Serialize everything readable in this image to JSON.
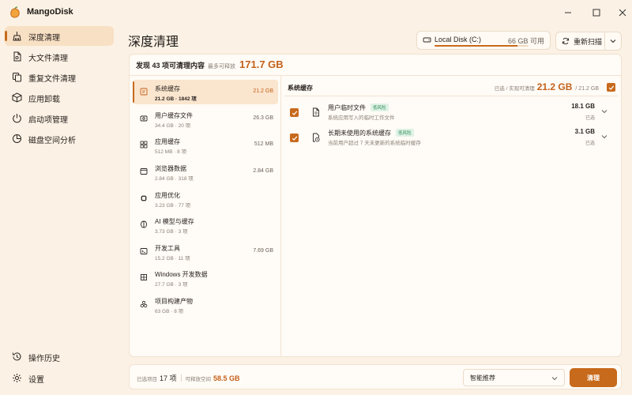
{
  "app": {
    "title": "MangoDisk",
    "accent": "#c76a1c",
    "accent_text": "#c4611a",
    "background": "#fbf1e4"
  },
  "sidebar": {
    "items": [
      {
        "label": "深度清理",
        "icon": "broom-icon",
        "active": true
      },
      {
        "label": "大文件清理",
        "icon": "large-file-icon",
        "active": false
      },
      {
        "label": "重复文件清理",
        "icon": "duplicate-file-icon",
        "active": false
      },
      {
        "label": "应用卸载",
        "icon": "package-icon",
        "active": false
      },
      {
        "label": "启动项管理",
        "icon": "power-icon",
        "active": false
      },
      {
        "label": "磁盘空间分析",
        "icon": "pie-chart-icon",
        "active": false
      }
    ],
    "bottom_items": [
      {
        "label": "操作历史",
        "icon": "history-icon"
      },
      {
        "label": "设置",
        "icon": "gear-icon"
      }
    ]
  },
  "header": {
    "page_title": "深度清理",
    "disk": {
      "name": "Local Disk (C:)",
      "free": "66 GB 可用",
      "used_fraction": 0.88
    },
    "rescan_label": "重新扫描"
  },
  "summary": {
    "label": "发现 43 项可清理内容",
    "sub": "最多可释放",
    "total": "171.7 GB"
  },
  "categories": [
    {
      "name": "系统缓存",
      "meta": "21.2 GB · 1842 项",
      "size": "21.2 GB",
      "icon": "system-cache-icon",
      "active": true
    },
    {
      "name": "用户缓存文件",
      "meta": "34.4 GB · 20 项",
      "size": "26.3 GB",
      "icon": "user-cache-icon",
      "active": false
    },
    {
      "name": "应用缓存",
      "meta": "512 MB · 8 项",
      "size": "512 MB",
      "icon": "app-cache-icon",
      "active": false
    },
    {
      "name": "浏览器数据",
      "meta": "2.84 GB · 318 项",
      "size": "2.84 GB",
      "icon": "browser-icon",
      "active": false
    },
    {
      "name": "应用优化",
      "meta": "3.23 GB · 77 项",
      "size": "",
      "icon": "chip-icon",
      "active": false
    },
    {
      "name": "AI 模型与缓存",
      "meta": "3.73 GB · 3 项",
      "size": "",
      "icon": "ai-model-icon",
      "active": false
    },
    {
      "name": "开发工具",
      "meta": "15.2 GB · 11 项",
      "size": "7.69 GB",
      "icon": "terminal-icon",
      "active": false
    },
    {
      "name": "Windows 开发数据",
      "meta": "27.7 GB · 3 项",
      "size": "",
      "icon": "windows-icon",
      "active": false
    },
    {
      "name": "项目构建产物",
      "meta": "63 GB · 8 项",
      "size": "",
      "icon": "build-artifacts-icon",
      "active": false
    }
  ],
  "detail": {
    "title": "系统缓存",
    "selected_label": "已选 / 实现可清理",
    "selected_value": "21.2 GB",
    "total": "/ 21.2 GB",
    "entries": [
      {
        "name": "用户临时文件",
        "badge": "低风险",
        "desc": "系统应用写入的临时工作文件",
        "size": "18.1 GB",
        "status": "已选",
        "icon": "document-icon",
        "checked": true
      },
      {
        "name": "长期未使用的系统缓存",
        "badge": "低风险",
        "desc": "当前用户超过 7 天未更新的系统临时缓存",
        "size": "3.1 GB",
        "status": "已选",
        "icon": "clock-file-icon",
        "checked": true
      }
    ]
  },
  "footer": {
    "selected_label": "已选项目",
    "selected_count": "17 项",
    "release_label": "可释放空间",
    "release_size": "58.5 GB",
    "strategy": "智能推荐",
    "clean_label": "清理"
  }
}
